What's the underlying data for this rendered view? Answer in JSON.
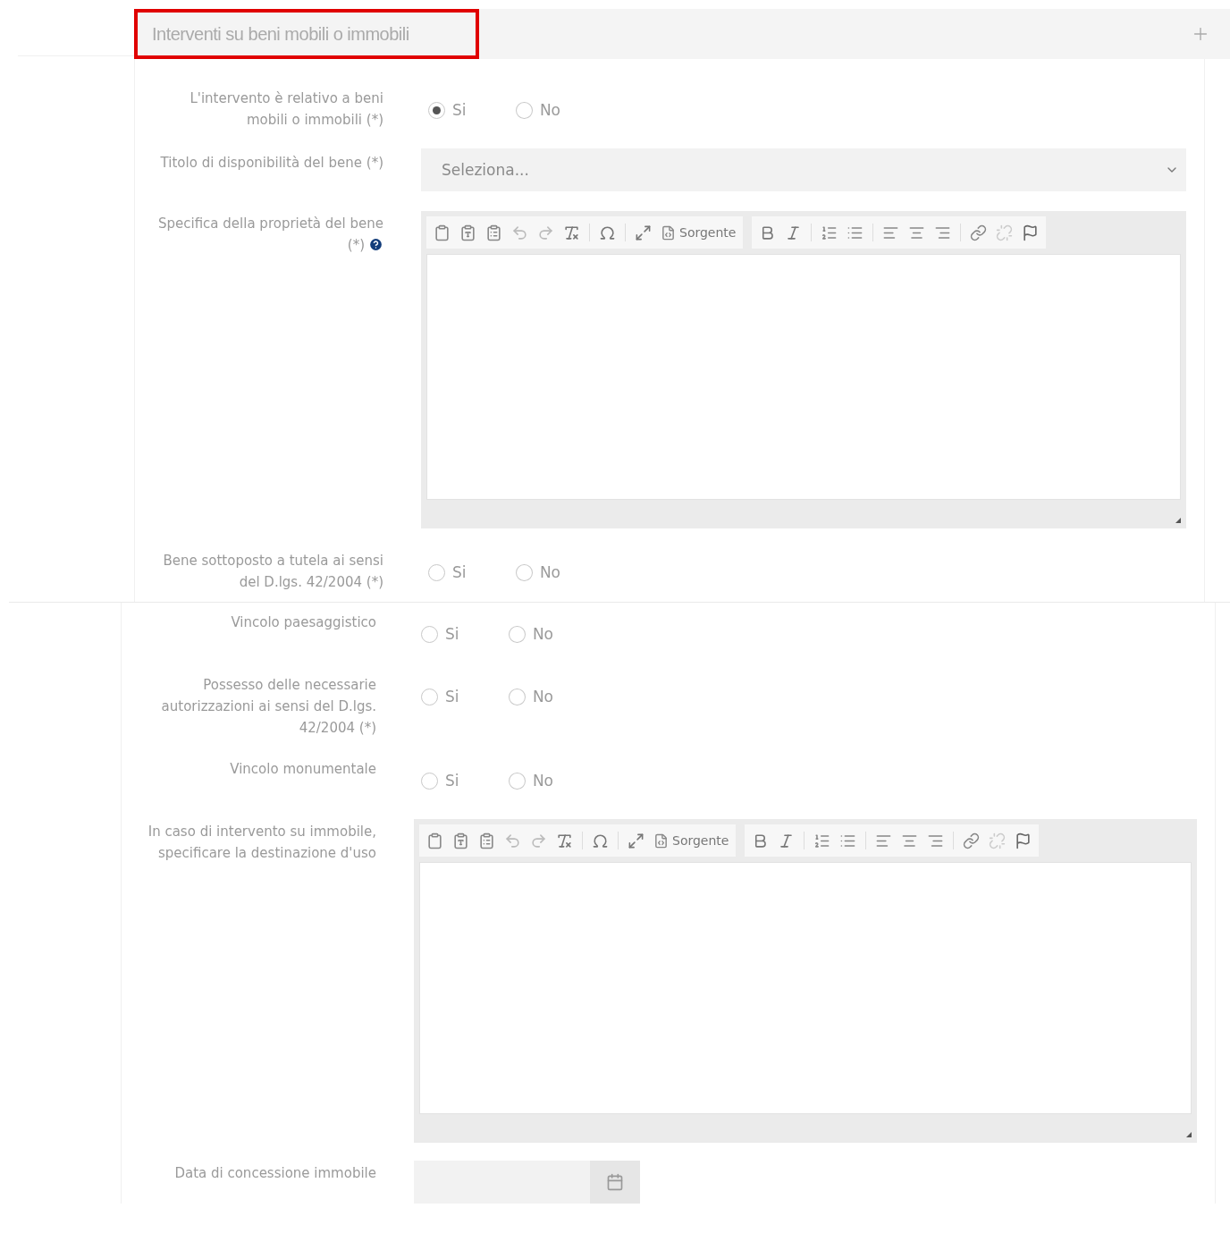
{
  "header": {
    "title": "Interventi su beni mobili o immobili"
  },
  "panels": [
    {
      "fields": [
        {
          "kind": "radio",
          "label": "L'intervento è relativo a beni mobili o immobili (*)",
          "help": false,
          "options": [
            {
              "label": "Si",
              "selected": true
            },
            {
              "label": "No",
              "selected": false
            }
          ]
        },
        {
          "kind": "select",
          "label": "Titolo di disponibilità del bene (*)",
          "help": false,
          "placeholder": "Seleziona..."
        },
        {
          "kind": "editor",
          "label": "Specifica della proprietà del bene (*)",
          "help": true,
          "source_label": "Sorgente"
        },
        {
          "kind": "radio",
          "label": "Bene sottoposto a tutela ai sensi del D.lgs. 42/2004 (*)",
          "help": false,
          "options": [
            {
              "label": "Si",
              "selected": false
            },
            {
              "label": "No",
              "selected": false
            }
          ]
        }
      ]
    },
    {
      "fields": [
        {
          "kind": "radio",
          "label": "Vincolo paesaggistico",
          "help": false,
          "options": [
            {
              "label": "Si",
              "selected": false
            },
            {
              "label": "No",
              "selected": false
            }
          ]
        },
        {
          "kind": "radio",
          "label": "Possesso delle necessarie autorizzazioni ai sensi del D.lgs. 42/2004 (*)",
          "help": false,
          "options": [
            {
              "label": "Si",
              "selected": false
            },
            {
              "label": "No",
              "selected": false
            }
          ]
        },
        {
          "kind": "radio",
          "label": "Vincolo monumentale",
          "help": false,
          "options": [
            {
              "label": "Si",
              "selected": false
            },
            {
              "label": "No",
              "selected": false
            }
          ]
        },
        {
          "kind": "editor",
          "label": "In caso di intervento su immobile, specificare la destinazione d'uso",
          "help": false,
          "source_label": "Sorgente"
        },
        {
          "kind": "date",
          "label": "Data di concessione immobile",
          "help": false
        }
      ]
    }
  ]
}
